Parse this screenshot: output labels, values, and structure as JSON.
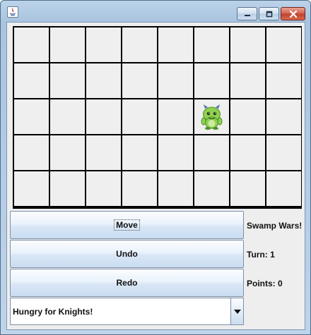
{
  "window": {
    "title": ""
  },
  "board": {
    "rows": 5,
    "cols": 8,
    "monster_position": {
      "row": 3,
      "col": 6
    }
  },
  "buttons": {
    "move": "Move",
    "undo": "Undo",
    "redo": "Redo"
  },
  "info": {
    "title": "Swamp Wars!",
    "turn": "Turn: 1",
    "points": "Points: 0"
  },
  "strategy_select": {
    "selected": "Hungry for Knights!"
  },
  "colors": {
    "monster_body": "#8fd14f",
    "monster_dark": "#4f8f2a",
    "monster_horns": "#4f6fb5",
    "cell_bg": "#efefef",
    "grid_line": "#000000"
  }
}
